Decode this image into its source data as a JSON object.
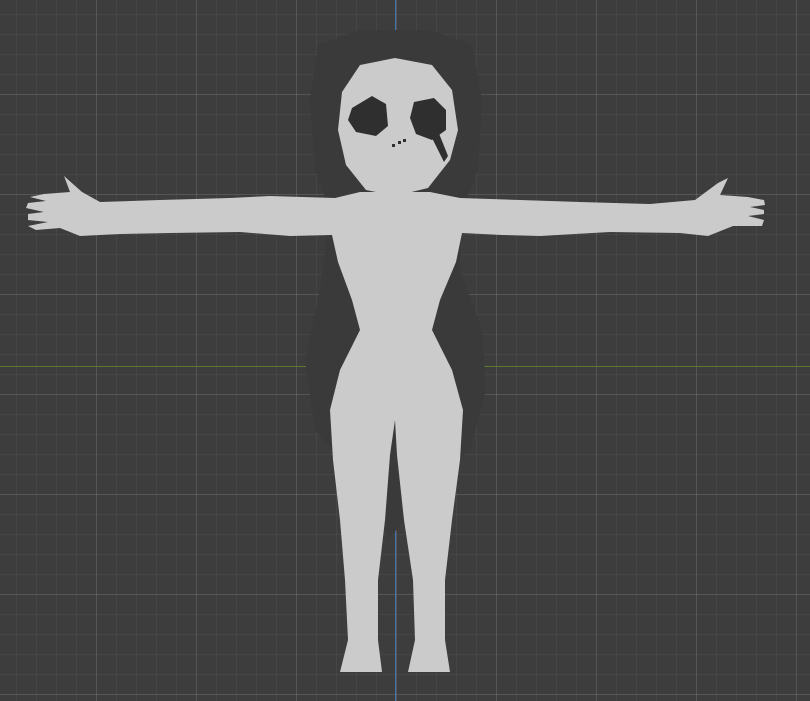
{
  "viewport": {
    "background_color": "#3d3d3d",
    "grid_major_color": "#4a4a4a",
    "grid_minor_color": "#424242",
    "axis_y_color": "#3f74b5",
    "axis_x_color": "#5b7a2f"
  },
  "model": {
    "pose": "T-pose",
    "body_color": "#cbcbcb",
    "hair_color": "#3a3a3a",
    "face_features_color": "#2f2f2f"
  }
}
